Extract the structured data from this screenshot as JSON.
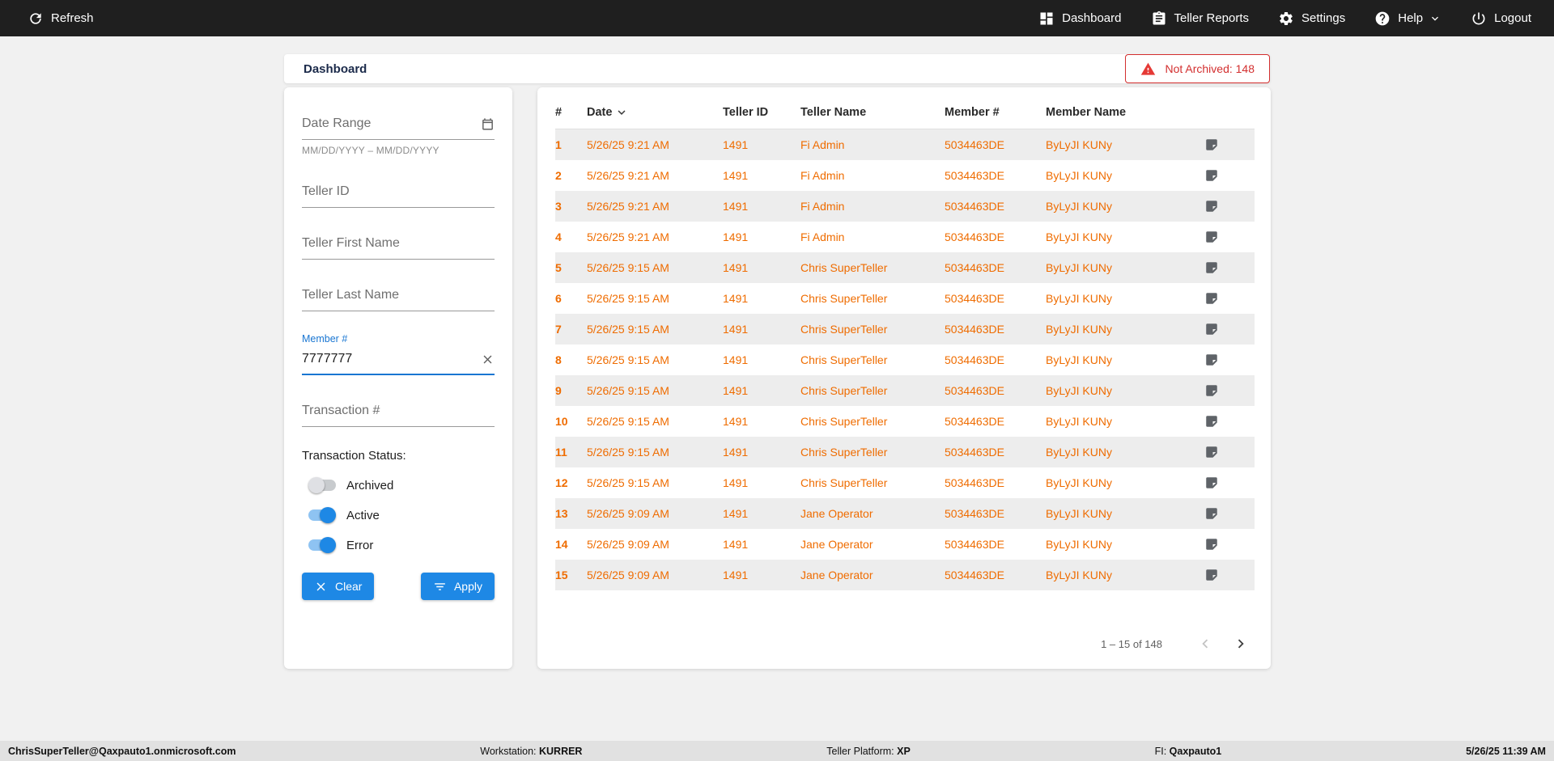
{
  "topbar": {
    "refresh_label": "Refresh",
    "items": [
      {
        "label": "Dashboard",
        "icon": "dashboard-icon"
      },
      {
        "label": "Teller Reports",
        "icon": "reports-icon"
      },
      {
        "label": "Settings",
        "icon": "settings-icon"
      },
      {
        "label": "Help",
        "icon": "help-icon"
      },
      {
        "label": "Logout",
        "icon": "logout-icon"
      }
    ]
  },
  "header": {
    "title": "Dashboard",
    "alert_badge": "Not Archived: 148"
  },
  "filters": {
    "date_range": {
      "placeholder": "Date Range",
      "helper": "MM/DD/YYYY – MM/DD/YYYY"
    },
    "teller_id": {
      "placeholder": "Teller ID"
    },
    "teller_first_name": {
      "placeholder": "Teller First Name"
    },
    "teller_last_name": {
      "placeholder": "Teller Last Name"
    },
    "member_number": {
      "label": "Member #",
      "value": "7777777"
    },
    "transaction_number": {
      "placeholder": "Transaction #"
    },
    "status_label": "Transaction Status:",
    "toggles": [
      {
        "label": "Archived",
        "on": false
      },
      {
        "label": "Active",
        "on": true
      },
      {
        "label": "Error",
        "on": true
      }
    ],
    "clear_button": "Clear",
    "apply_button": "Apply"
  },
  "table": {
    "columns": [
      "#",
      "Date",
      "Teller ID",
      "Teller Name",
      "Member #",
      "Member Name"
    ],
    "rows": [
      {
        "num": "1",
        "date": "5/26/25 9:21 AM",
        "teller_id": "1491",
        "teller_name": "Fi Admin",
        "member_num": "5034463DE",
        "member_name": "ByLyJI KUNy"
      },
      {
        "num": "2",
        "date": "5/26/25 9:21 AM",
        "teller_id": "1491",
        "teller_name": "Fi Admin",
        "member_num": "5034463DE",
        "member_name": "ByLyJI KUNy"
      },
      {
        "num": "3",
        "date": "5/26/25 9:21 AM",
        "teller_id": "1491",
        "teller_name": "Fi Admin",
        "member_num": "5034463DE",
        "member_name": "ByLyJI KUNy"
      },
      {
        "num": "4",
        "date": "5/26/25 9:21 AM",
        "teller_id": "1491",
        "teller_name": "Fi Admin",
        "member_num": "5034463DE",
        "member_name": "ByLyJI KUNy"
      },
      {
        "num": "5",
        "date": "5/26/25 9:15 AM",
        "teller_id": "1491",
        "teller_name": "Chris SuperTeller",
        "member_num": "5034463DE",
        "member_name": "ByLyJI KUNy"
      },
      {
        "num": "6",
        "date": "5/26/25 9:15 AM",
        "teller_id": "1491",
        "teller_name": "Chris SuperTeller",
        "member_num": "5034463DE",
        "member_name": "ByLyJI KUNy"
      },
      {
        "num": "7",
        "date": "5/26/25 9:15 AM",
        "teller_id": "1491",
        "teller_name": "Chris SuperTeller",
        "member_num": "5034463DE",
        "member_name": "ByLyJI KUNy"
      },
      {
        "num": "8",
        "date": "5/26/25 9:15 AM",
        "teller_id": "1491",
        "teller_name": "Chris SuperTeller",
        "member_num": "5034463DE",
        "member_name": "ByLyJI KUNy"
      },
      {
        "num": "9",
        "date": "5/26/25 9:15 AM",
        "teller_id": "1491",
        "teller_name": "Chris SuperTeller",
        "member_num": "5034463DE",
        "member_name": "ByLyJI KUNy"
      },
      {
        "num": "10",
        "date": "5/26/25 9:15 AM",
        "teller_id": "1491",
        "teller_name": "Chris SuperTeller",
        "member_num": "5034463DE",
        "member_name": "ByLyJI KUNy"
      },
      {
        "num": "11",
        "date": "5/26/25 9:15 AM",
        "teller_id": "1491",
        "teller_name": "Chris SuperTeller",
        "member_num": "5034463DE",
        "member_name": "ByLyJI KUNy"
      },
      {
        "num": "12",
        "date": "5/26/25 9:15 AM",
        "teller_id": "1491",
        "teller_name": "Chris SuperTeller",
        "member_num": "5034463DE",
        "member_name": "ByLyJI KUNy"
      },
      {
        "num": "13",
        "date": "5/26/25 9:09 AM",
        "teller_id": "1491",
        "teller_name": "Jane Operator",
        "member_num": "5034463DE",
        "member_name": "ByLyJI KUNy"
      },
      {
        "num": "14",
        "date": "5/26/25 9:09 AM",
        "teller_id": "1491",
        "teller_name": "Jane Operator",
        "member_num": "5034463DE",
        "member_name": "ByLyJI KUNy"
      },
      {
        "num": "15",
        "date": "5/26/25 9:09 AM",
        "teller_id": "1491",
        "teller_name": "Jane Operator",
        "member_num": "5034463DE",
        "member_name": "ByLyJI KUNy"
      }
    ],
    "pagination": {
      "range": "1 – 15 of 148"
    }
  },
  "statusbar": {
    "user": "ChrisSuperTeller@Qaxpauto1.onmicrosoft.com",
    "workstation_label": "Workstation: ",
    "workstation": "KURRER",
    "platform_label": "Teller Platform: ",
    "platform": "XP",
    "fi_label": "FI: ",
    "fi": "Qaxpauto1",
    "datetime": "5/26/25 11:39 AM"
  },
  "colors": {
    "accent_blue": "#1e88e5",
    "focus_blue": "#1976d2",
    "row_orange": "#ef6c00",
    "alert_red": "#d32f2f",
    "topbar_bg": "#1f1f1f"
  }
}
